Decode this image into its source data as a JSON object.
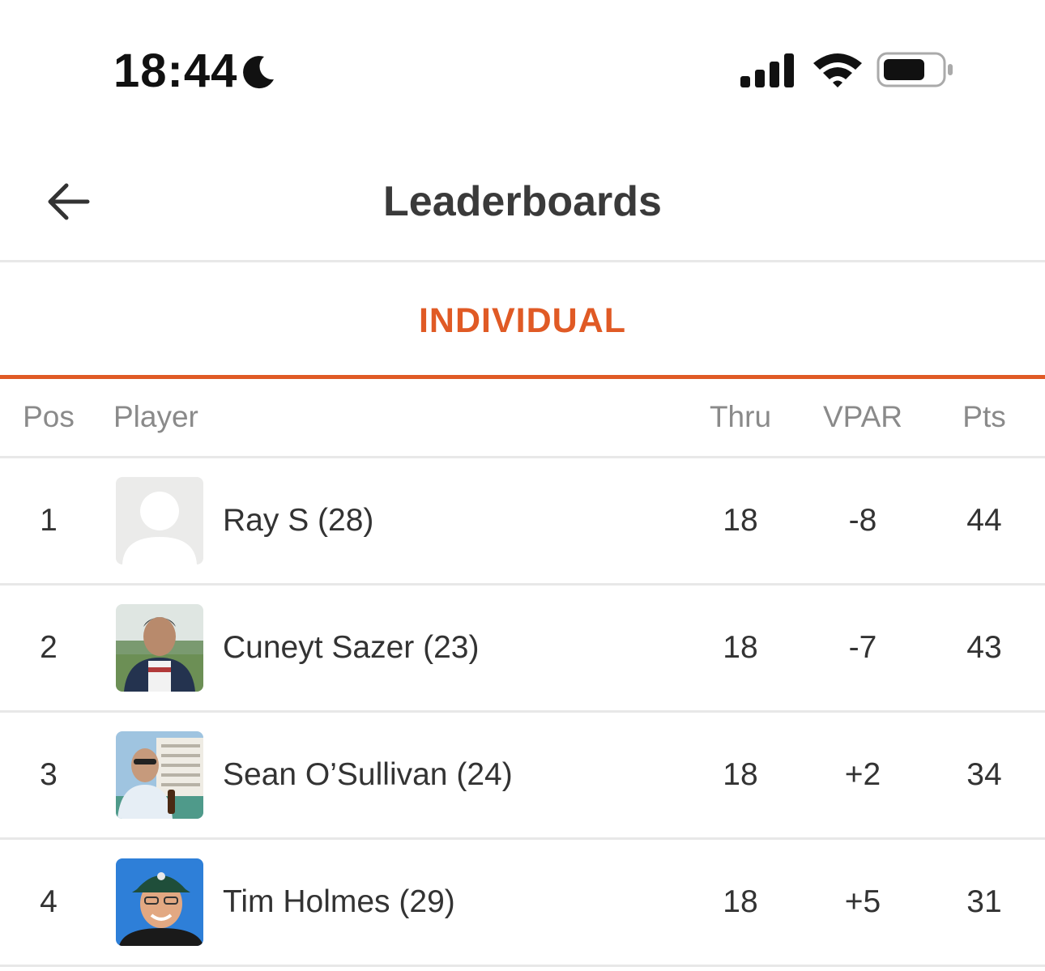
{
  "status_bar": {
    "time": "18:44",
    "focus_icon": "moon-icon",
    "signal_icon": "cellular-signal-icon",
    "wifi_icon": "wifi-icon",
    "battery_icon": "battery-icon"
  },
  "nav": {
    "back_icon": "arrow-left-icon",
    "title": "Leaderboards"
  },
  "tabs": [
    {
      "label": "INDIVIDUAL",
      "active": true
    }
  ],
  "colors": {
    "accent": "#e05a25",
    "divider": "#e8e8e8",
    "header_text": "#8a8a8a"
  },
  "table": {
    "columns": [
      "Pos",
      "Player",
      "Thru",
      "VPAR",
      "Pts"
    ],
    "rows": [
      {
        "pos": "1",
        "player": "Ray S (28)",
        "thru": "18",
        "vpar": "-8",
        "pts": "44",
        "avatar": "default-avatar"
      },
      {
        "pos": "2",
        "player": "Cuneyt Sazer (23)",
        "thru": "18",
        "vpar": "-7",
        "pts": "43",
        "avatar": "photo"
      },
      {
        "pos": "3",
        "player": "Sean O’Sullivan (24)",
        "thru": "18",
        "vpar": "+2",
        "pts": "34",
        "avatar": "photo"
      },
      {
        "pos": "4",
        "player": "Tim Holmes (29)",
        "thru": "18",
        "vpar": "+5",
        "pts": "31",
        "avatar": "photo"
      }
    ]
  }
}
